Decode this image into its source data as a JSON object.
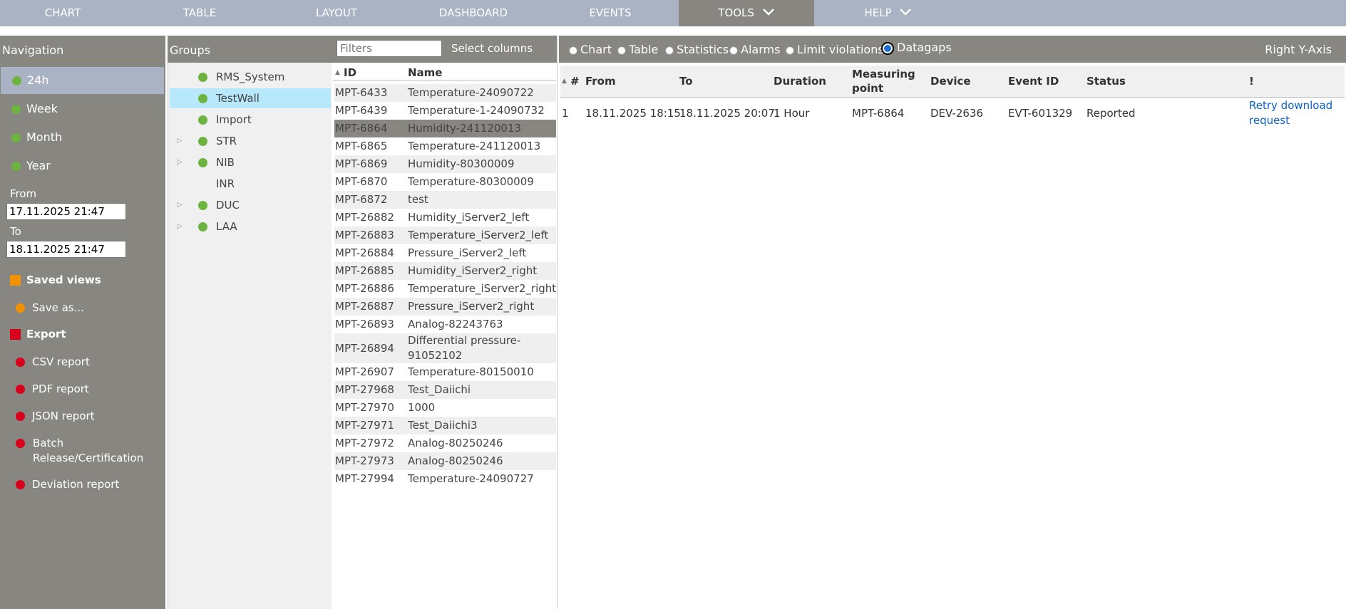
{
  "menu": {
    "items": [
      {
        "label": "CHART"
      },
      {
        "label": "TABLE"
      },
      {
        "label": "LAYOUT"
      },
      {
        "label": "DASHBOARD"
      },
      {
        "label": "EVENTS"
      },
      {
        "label": "TOOLS",
        "active": true,
        "dropdown": true
      },
      {
        "label": "HELP",
        "dropdown": true
      }
    ]
  },
  "navigation": {
    "title": "Navigation",
    "ranges": [
      {
        "label": "24h",
        "selected": true
      },
      {
        "label": "Week"
      },
      {
        "label": "Month"
      },
      {
        "label": "Year"
      }
    ],
    "from_label": "From",
    "from_value": "17.11.2025 21:47",
    "to_label": "To",
    "to_value": "18.11.2025 21:47",
    "saved_views_label": "Saved views",
    "save_as_label": "Save as...",
    "export_label": "Export",
    "reports": [
      {
        "label": "CSV report"
      },
      {
        "label": "PDF report"
      },
      {
        "label": "JSON report"
      },
      {
        "label": "Batch Release/Certification"
      },
      {
        "label": "Deviation report"
      }
    ]
  },
  "groups": {
    "title": "Groups",
    "items": [
      {
        "label": "RMS_System",
        "expandable": false
      },
      {
        "label": "TestWall",
        "expandable": false,
        "selected": true
      },
      {
        "label": "Import",
        "expandable": false
      },
      {
        "label": "STR",
        "expandable": true
      },
      {
        "label": "NIB",
        "expandable": true
      },
      {
        "label": "INR",
        "expandable": false,
        "no_dot": true
      },
      {
        "label": "DUC",
        "expandable": true
      },
      {
        "label": "LAA",
        "expandable": true
      }
    ]
  },
  "points": {
    "filter_placeholder": "Filters",
    "select_columns_label": "Select columns",
    "col_id": "ID",
    "col_name": "Name",
    "rows": [
      {
        "id": "MPT-6433",
        "name": "Temperature-24090722"
      },
      {
        "id": "MPT-6439",
        "name": "Temperature-1-24090732"
      },
      {
        "id": "MPT-6864",
        "name": "Humidity-241120013",
        "selected": true
      },
      {
        "id": "MPT-6865",
        "name": "Temperature-241120013"
      },
      {
        "id": "MPT-6869",
        "name": "Humidity-80300009"
      },
      {
        "id": "MPT-6870",
        "name": "Temperature-80300009"
      },
      {
        "id": "MPT-6872",
        "name": "test"
      },
      {
        "id": "MPT-26882",
        "name": "Humidity_iServer2_left"
      },
      {
        "id": "MPT-26883",
        "name": "Temperature_iServer2_left"
      },
      {
        "id": "MPT-26884",
        "name": "Pressure_iServer2_left"
      },
      {
        "id": "MPT-26885",
        "name": "Humidity_iServer2_right"
      },
      {
        "id": "MPT-26886",
        "name": "Temperature_iServer2_right"
      },
      {
        "id": "MPT-26887",
        "name": "Pressure_iServer2_right"
      },
      {
        "id": "MPT-26893",
        "name": "Analog-82243763"
      },
      {
        "id": "MPT-26894",
        "name": "Differential pressure-91052102"
      },
      {
        "id": "MPT-26907",
        "name": "Temperature-80150010"
      },
      {
        "id": "MPT-27968",
        "name": "Test_Daiichi"
      },
      {
        "id": "MPT-27970",
        "name": "1000"
      },
      {
        "id": "MPT-27971",
        "name": "Test_Daiichi3"
      },
      {
        "id": "MPT-27972",
        "name": "Analog-80250246"
      },
      {
        "id": "MPT-27973",
        "name": "Analog-80250246"
      },
      {
        "id": "MPT-27994",
        "name": "Temperature-24090727"
      }
    ]
  },
  "views": {
    "tabs": [
      {
        "label": "Chart"
      },
      {
        "label": "Table"
      },
      {
        "label": "Statistics"
      },
      {
        "label": "Alarms"
      },
      {
        "label": "Limit violations"
      },
      {
        "label": "Datagaps",
        "selected": true
      }
    ],
    "right_axis_label": "Right Y-Axis"
  },
  "datagaps": {
    "headers": {
      "num": "#",
      "from": "From",
      "to": "To",
      "duration": "Duration",
      "measuring_point": "Measuring point",
      "device": "Device",
      "event_id": "Event ID",
      "status": "Status",
      "action": "!"
    },
    "rows": [
      {
        "num": "1",
        "from": "18.11.2025 18:15",
        "to": "18.11.2025 20:07",
        "duration": "1 Hour",
        "measuring_point": "MPT-6864",
        "device": "DEV-2636",
        "event_id": "EVT-601329",
        "status": "Reported",
        "action": "Retry download request"
      }
    ]
  }
}
